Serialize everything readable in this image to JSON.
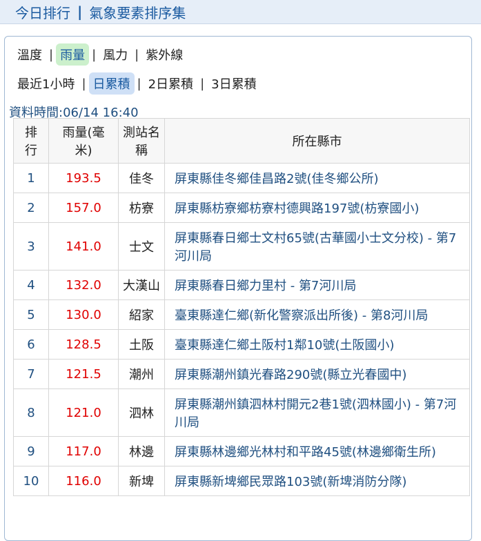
{
  "header": {
    "title_left": "今日排行",
    "separator": "|",
    "title_right": "氣象要素排序集"
  },
  "categories": [
    "溫度",
    "雨量",
    "風力",
    "紫外線"
  ],
  "selected_category": "雨量",
  "periods": [
    "最近1小時",
    "日累積",
    "2日累積",
    "3日累積"
  ],
  "selected_period": "日累積",
  "data_time": "資料時間:06/14 16:40",
  "table": {
    "headers": [
      "排\n行",
      "雨量(毫\n米)",
      "測站名\n稱",
      "所在縣市"
    ],
    "rows": [
      {
        "rank": "1",
        "value": "193.5",
        "station": "佳冬",
        "location": "屏東縣佳冬鄉佳昌路2號(佳冬鄉公所)"
      },
      {
        "rank": "2",
        "value": "157.0",
        "station": "枋寮",
        "location": "屏東縣枋寮鄉枋寮村德興路197號(枋寮國小)"
      },
      {
        "rank": "3",
        "value": "141.0",
        "station": "士文",
        "location": "屏東縣春日鄉士文村65號(古華國小士文分校) - 第7河川局"
      },
      {
        "rank": "4",
        "value": "132.0",
        "station": "大漢山",
        "location": "屏東縣春日鄉力里村 - 第7河川局"
      },
      {
        "rank": "5",
        "value": "130.0",
        "station": "紹家",
        "location": "臺東縣達仁鄉(新化警察派出所後) - 第8河川局"
      },
      {
        "rank": "6",
        "value": "128.5",
        "station": "土阪",
        "location": "臺東縣達仁鄉土阪村1鄰10號(土阪國小)"
      },
      {
        "rank": "7",
        "value": "121.5",
        "station": "潮州",
        "location": "屏東縣潮州鎮光春路290號(縣立光春國中)"
      },
      {
        "rank": "8",
        "value": "121.0",
        "station": "泗林",
        "location": "屏東縣潮州鎮泗林村開元2巷1號(泗林國小) - 第7河川局"
      },
      {
        "rank": "9",
        "value": "117.0",
        "station": "林邊",
        "location": "屏東縣林邊鄉光林村和平路45號(林邊鄉衛生所)"
      },
      {
        "rank": "10",
        "value": "116.0",
        "station": "新埤",
        "location": "屏東縣新埤鄉民眾路103號(新埤消防分隊)"
      }
    ]
  }
}
